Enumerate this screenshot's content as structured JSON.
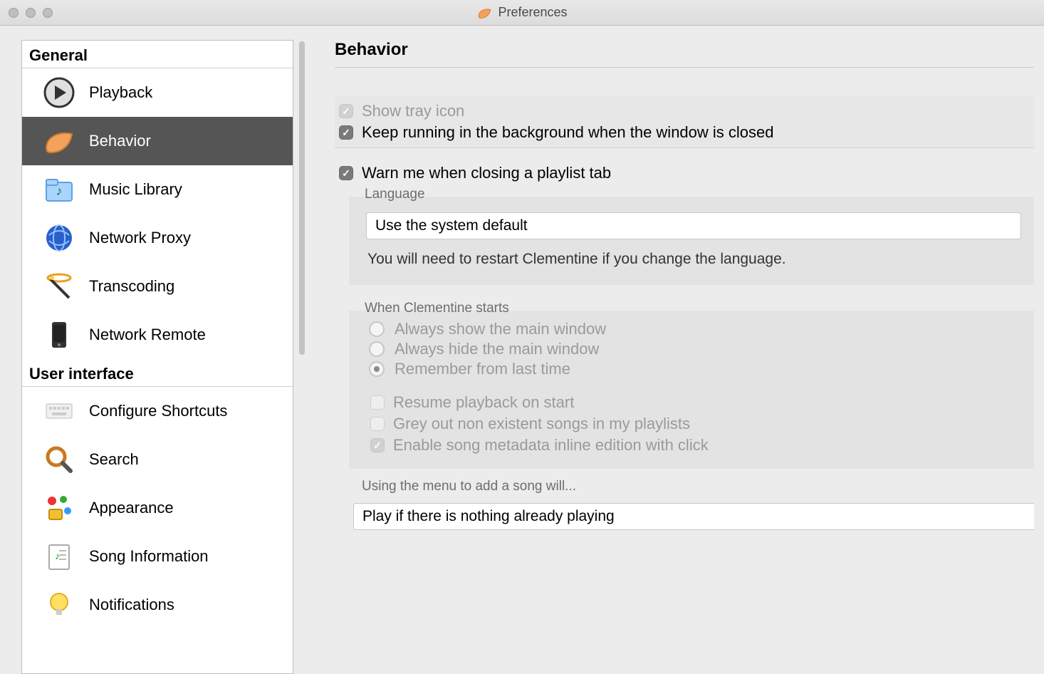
{
  "window": {
    "title": "Preferences"
  },
  "sidebar": {
    "groups": [
      {
        "label": "General",
        "items": [
          {
            "label": "Playback",
            "icon": "play"
          },
          {
            "label": "Behavior",
            "icon": "clementine",
            "selected": true
          },
          {
            "label": "Music Library",
            "icon": "folder"
          },
          {
            "label": "Network Proxy",
            "icon": "globe"
          },
          {
            "label": "Transcoding",
            "icon": "wand"
          },
          {
            "label": "Network Remote",
            "icon": "phone"
          }
        ]
      },
      {
        "label": "User interface",
        "items": [
          {
            "label": "Configure Shortcuts",
            "icon": "keyboard"
          },
          {
            "label": "Search",
            "icon": "search"
          },
          {
            "label": "Appearance",
            "icon": "appearance"
          },
          {
            "label": "Song Information",
            "icon": "doc"
          },
          {
            "label": "Notifications",
            "icon": "bulb"
          }
        ]
      }
    ]
  },
  "page": {
    "heading": "Behavior",
    "tray": {
      "show_label": "Show tray icon",
      "show_checked": true,
      "show_disabled": true,
      "keep_running_label": "Keep running in the background when the window is closed",
      "keep_running_checked": true
    },
    "warn": {
      "label": "Warn me when closing a playlist tab",
      "checked": true
    },
    "language": {
      "legend": "Language",
      "selected": "Use the system default",
      "hint": "You will need to restart Clementine if you change the language."
    },
    "startup": {
      "legend": "When Clementine starts",
      "options": [
        {
          "label": "Always show the main window",
          "selected": false
        },
        {
          "label": "Always hide the main window",
          "selected": false
        },
        {
          "label": "Remember from last time",
          "selected": true
        }
      ],
      "resume": {
        "label": "Resume playback on start",
        "checked": false
      },
      "greyout": {
        "label": "Grey out non existent songs in my playlists",
        "checked": false
      },
      "inline": {
        "label": "Enable song metadata inline edition with click",
        "checked": true
      }
    },
    "addsong": {
      "legend": "Using the menu to add a song will...",
      "selected": "Play if there is nothing already playing"
    }
  }
}
